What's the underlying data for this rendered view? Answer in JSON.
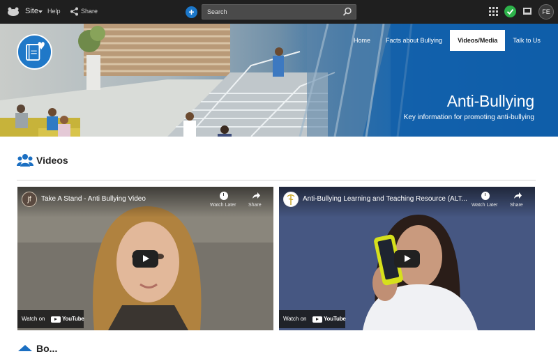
{
  "topbar": {
    "site_label": "Site",
    "help_label": "Help",
    "share_label": "Share",
    "search_placeholder": "Search",
    "avatar_initials": "FE"
  },
  "hero": {
    "nav": [
      {
        "label": "Home",
        "active": false
      },
      {
        "label": "Facts about Bullying",
        "active": false
      },
      {
        "label": "Videos/Media",
        "active": true
      },
      {
        "label": "Talk to Us",
        "active": false
      }
    ],
    "title": "Anti-Bullying",
    "subtitle": "Key information for promoting anti-bullying"
  },
  "videos_section": {
    "heading": "Videos",
    "videos": [
      {
        "channel_initials": "jf",
        "title": "Take A Stand - Anti Bullying Video",
        "watch_later": "Watch Later",
        "share": "Share",
        "watch_on": "Watch on",
        "youtube": "YouTube"
      },
      {
        "title": "Anti-Bullying Learning and Teaching Resource (ALT...",
        "watch_later": "Watch Later",
        "share": "Share",
        "watch_on": "Watch on",
        "youtube": "YouTube"
      }
    ]
  },
  "next_section": {
    "heading": "Bo..."
  },
  "colors": {
    "topbar": "#1f1f1f",
    "accent_blue": "#1b77c9",
    "hero_blue": "#0f5da9",
    "status_green": "#2db34a"
  },
  "icons": [
    "site-logo-icon",
    "chevron-down-icon",
    "share-icon",
    "plus-icon",
    "search-icon",
    "apps-grid-icon",
    "check-icon",
    "monitor-icon",
    "book-heart-icon",
    "users-icon",
    "clock-icon",
    "play-icon",
    "youtube-icon"
  ]
}
